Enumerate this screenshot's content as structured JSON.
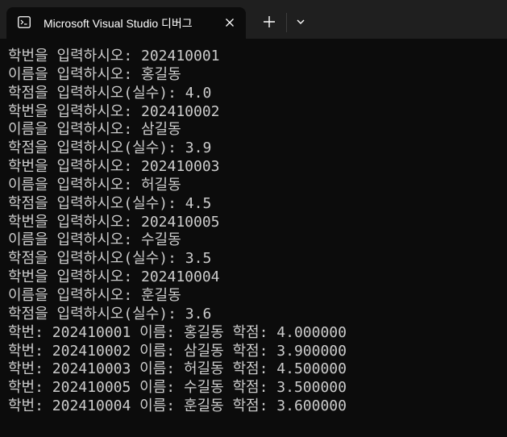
{
  "window": {
    "tab_title": "Microsoft Visual Studio 디버그",
    "tab_icon": "console-icon",
    "close_icon": "close-icon",
    "new_tab_icon": "plus-icon",
    "dropdown_icon": "chevron-down-icon"
  },
  "colors": {
    "titlebar_bg": "#1f1f1f",
    "terminal_bg": "#0c0c0c",
    "text": "#cccccc"
  },
  "console": {
    "lines": [
      "학번을 입력하시오: 202410001",
      "이름을 입력하시오: 홍길동",
      "학점을 입력하시오(실수): 4.0",
      "학번을 입력하시오: 202410002",
      "이름을 입력하시오: 삼길동",
      "학점을 입력하시오(실수): 3.9",
      "학번을 입력하시오: 202410003",
      "이름을 입력하시오: 허길동",
      "학점을 입력하시오(실수): 4.5",
      "학번을 입력하시오: 202410005",
      "이름을 입력하시오: 수길동",
      "학점을 입력하시오(실수): 3.5",
      "학번을 입력하시오: 202410004",
      "이름을 입력하시오: 훈길동",
      "학점을 입력하시오(실수): 3.6",
      "학번: 202410001 이름: 홍길동 학점: 4.000000",
      "학번: 202410002 이름: 삼길동 학점: 3.900000",
      "학번: 202410003 이름: 허길동 학점: 4.500000",
      "학번: 202410005 이름: 수길동 학점: 3.500000",
      "학번: 202410004 이름: 훈길동 학점: 3.600000"
    ]
  }
}
